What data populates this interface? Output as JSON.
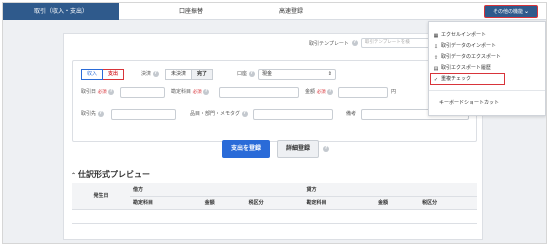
{
  "nav": {
    "tabs": [
      {
        "label": "取引（収入・支出）"
      },
      {
        "label": "口座振替"
      },
      {
        "label": "高速登録"
      }
    ],
    "other_features": "その他の機能"
  },
  "template": {
    "label": "取引テンプレート",
    "placeholder": "取引テンプレートを検"
  },
  "form": {
    "type_options": [
      "収入",
      "支出"
    ],
    "settlement_label": "決済",
    "settlement_options": [
      "未決済",
      "完了"
    ],
    "account_label": "口座",
    "account_value": "現金",
    "date_label": "取引日",
    "account_item_label": "勘定科目",
    "amount_label": "金額",
    "required": "必須",
    "yen_unit": "円",
    "partner_label": "取引先",
    "tags_label": "品目・部門・メモタグ",
    "remarks_label": "備考"
  },
  "buttons": {
    "register_expense": "支出を登録",
    "detail_register": "詳細登録"
  },
  "preview": {
    "title": "仕訳形式プレビュー",
    "occurrence_date": "発生日",
    "debit": "借方",
    "credit": "貸方",
    "columns": [
      "勘定科目",
      "金額",
      "税区分",
      "勘定科目",
      "金額",
      "税区分"
    ]
  },
  "menu": {
    "items": [
      {
        "label": "エクセルインポート",
        "icon": "table-icon"
      },
      {
        "label": "取引データのインポート",
        "icon": "import-icon"
      },
      {
        "label": "取引データのエクスポート",
        "icon": "export-icon"
      },
      {
        "label": "取引エクスポート履歴",
        "icon": "history-icon"
      },
      {
        "label": "重複チェック",
        "icon": "check-icon"
      },
      {
        "label": "キーボードショートカット",
        "icon": ""
      }
    ]
  },
  "colors": {
    "nav_active": "#2f5a8c",
    "primary": "#2a6bd8",
    "highlight": "#d8343a"
  }
}
